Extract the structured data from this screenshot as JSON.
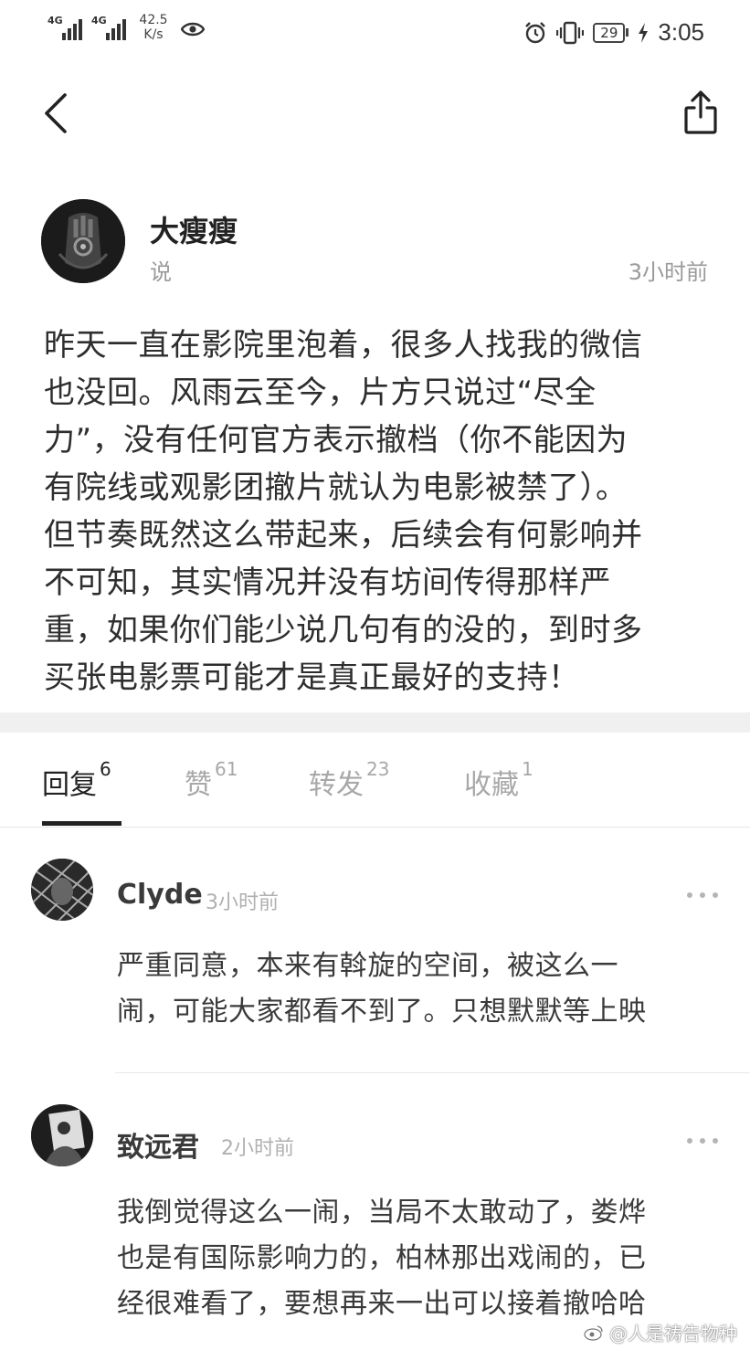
{
  "status_bar": {
    "signal_1_label": "4G",
    "signal_2_label": "4G",
    "net_speed_value": "42.5",
    "net_speed_unit": "K/s",
    "battery_level": "29",
    "time": "3:05"
  },
  "nav": {
    "back_icon": "chevron-left-icon",
    "share_icon": "share-icon"
  },
  "post": {
    "author_name": "大瘦瘦",
    "author_verb": "说",
    "time_ago": "3小时前",
    "lines": [
      "昨天一直在影院里泡着，很多人找我的微信",
      "也没回。风雨云至今，片方只说过“尽全",
      "力”，没有任何官方表示撤档（你不能因为",
      "有院线或观影团撤片就认为电影被禁了）。",
      "但节奏既然这么带起来，后续会有何影响并",
      "不可知，其实情况并没有坊间传得那样严",
      "重，如果你们能少说几句有的没的，到时多",
      "买张电影票可能才是真正最好的支持！"
    ]
  },
  "tabs": [
    {
      "label": "回复",
      "count": "6"
    },
    {
      "label": "赞",
      "count": "61"
    },
    {
      "label": "转发",
      "count": "23"
    },
    {
      "label": "收藏",
      "count": "1"
    }
  ],
  "comments": [
    {
      "name": "Clyde",
      "time_ago": "3小时前",
      "lines": [
        "严重同意，本来有斡旋的空间，被这么一",
        "闹，可能大家都看不到了。只想默默等上映"
      ]
    },
    {
      "name": "致远君",
      "time_ago": "2小时前",
      "lines": [
        "我倒觉得这么一闹，当局不太敢动了，娄烨",
        "也是有国际影响力的，柏林那出戏闹的，已",
        "经很难看了，要想再来一出可以接着撤哈哈"
      ]
    }
  ],
  "watermark": "@人是祷告物种",
  "colors": {
    "text_primary": "#2e2e2e",
    "text_secondary": "#9a9a9a",
    "divider": "#e8e8e8",
    "band": "#f0f0f0"
  }
}
